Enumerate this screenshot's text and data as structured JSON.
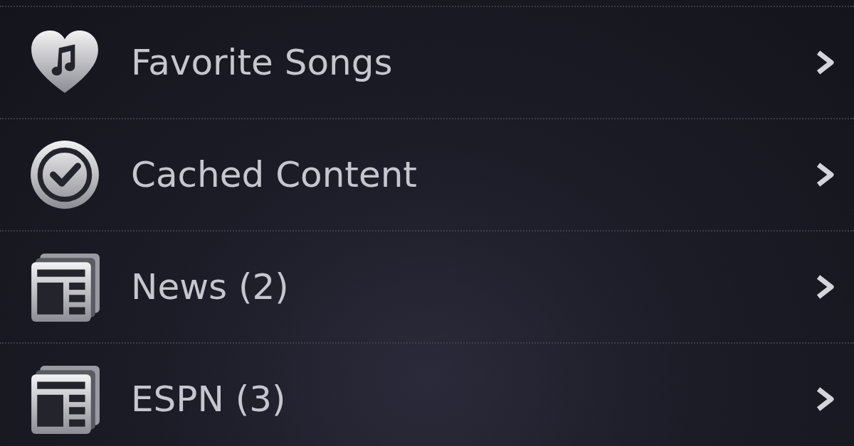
{
  "rows": [
    {
      "kind": "favorites",
      "label": "Favorite Songs"
    },
    {
      "kind": "cached",
      "label": "Cached Content"
    },
    {
      "kind": "feed",
      "label": "News (2)"
    },
    {
      "kind": "feed",
      "label": "ESPN (3)"
    }
  ]
}
